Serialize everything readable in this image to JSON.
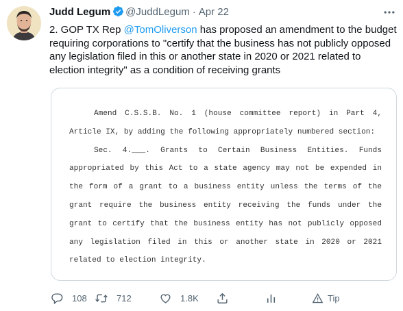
{
  "tweet": {
    "author_name": "Judd Legum",
    "handle": "@JuddLegum",
    "separator": "·",
    "date": "Apr 22",
    "text_prefix": "2. GOP TX Rep ",
    "mention": "@TomOliverson",
    "text_suffix": " has proposed an amendment to the budget requiring corporations to \"certify that the business has not publicly opposed any legislation filed in this or another state in 2020 or 2021 related to election integrity\" as a condition of receiving grants"
  },
  "document": {
    "paragraph_1": "Amend C.S.S.B. No. 1 (house committee report) in Part 4, Article IX, by adding the following appropriately numbered section:",
    "paragraph_2": "Sec. 4.___. Grants to Certain Business Entities. Funds appropriated by this Act to a state agency may not be expended in the form of a grant to a business entity unless the terms of the grant require the business entity receiving the funds under the grant to certify that the business entity has not publicly opposed any legislation filed in this or another state in 2020 or 2021 related to election integrity."
  },
  "actions": {
    "replies": "108",
    "retweets": "712",
    "likes": "1.8K",
    "tip_label": "Tip"
  },
  "icons": {
    "verified": "verified-badge-icon",
    "more": "more-options-icon",
    "reply": "reply-icon",
    "retweet": "retweet-icon",
    "like": "heart-icon",
    "share": "share-icon",
    "analytics": "analytics-icon",
    "tip": "tip-icon"
  },
  "colors": {
    "accent": "#1d9bf0",
    "secondary_text": "#536471"
  }
}
